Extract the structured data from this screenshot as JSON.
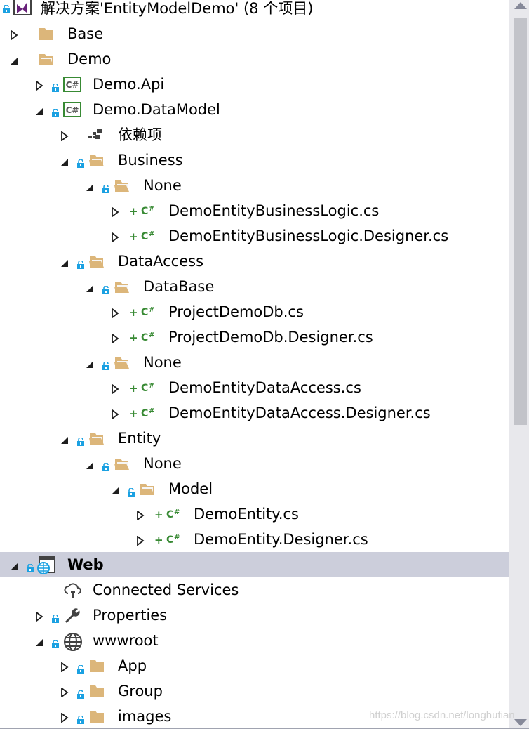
{
  "colors": {
    "selected_row": "#cccedb",
    "folder": "#dcb67a",
    "csharp": "#388a34",
    "lock": "#1ba1e2",
    "scrollbar_thumb": "#c2c3c9"
  },
  "tree": [
    {
      "label": "解决方案'EntityModelDemo' (8 个项目)",
      "level": -1,
      "arrow": "none",
      "lock": true,
      "icon": "solution-icon"
    },
    {
      "label": "Base",
      "level": 0,
      "arrow": "collapsed",
      "lock": false,
      "icon": "folder-icon"
    },
    {
      "label": "Demo",
      "level": 0,
      "arrow": "expanded",
      "lock": false,
      "icon": "folder-open-icon"
    },
    {
      "label": "Demo.Api",
      "level": 1,
      "arrow": "collapsed",
      "lock": true,
      "icon": "csharp-project-icon"
    },
    {
      "label": "Demo.DataModel",
      "level": 1,
      "arrow": "expanded",
      "lock": true,
      "icon": "csharp-project-icon"
    },
    {
      "label": "依赖项",
      "level": 2,
      "arrow": "collapsed",
      "lock": false,
      "icon": "dependencies-icon"
    },
    {
      "label": "Business",
      "level": 2,
      "arrow": "expanded",
      "lock": true,
      "icon": "folder-open-icon"
    },
    {
      "label": "None",
      "level": 3,
      "arrow": "expanded",
      "lock": true,
      "icon": "folder-open-icon"
    },
    {
      "label": "DemoEntityBusinessLogic.cs",
      "level": 4,
      "arrow": "collapsed",
      "lock": false,
      "icon": "csharp-file-icon",
      "added": true
    },
    {
      "label": "DemoEntityBusinessLogic.Designer.cs",
      "level": 4,
      "arrow": "collapsed",
      "lock": false,
      "icon": "csharp-file-icon",
      "added": true
    },
    {
      "label": "DataAccess",
      "level": 2,
      "arrow": "expanded",
      "lock": true,
      "icon": "folder-open-icon"
    },
    {
      "label": "DataBase",
      "level": 3,
      "arrow": "expanded",
      "lock": true,
      "icon": "folder-open-icon"
    },
    {
      "label": "ProjectDemoDb.cs",
      "level": 4,
      "arrow": "collapsed",
      "lock": false,
      "icon": "csharp-file-icon",
      "added": true
    },
    {
      "label": "ProjectDemoDb.Designer.cs",
      "level": 4,
      "arrow": "collapsed",
      "lock": false,
      "icon": "csharp-file-icon",
      "added": true
    },
    {
      "label": "None",
      "level": 3,
      "arrow": "expanded",
      "lock": true,
      "icon": "folder-open-icon"
    },
    {
      "label": "DemoEntityDataAccess.cs",
      "level": 4,
      "arrow": "collapsed",
      "lock": false,
      "icon": "csharp-file-icon",
      "added": true
    },
    {
      "label": "DemoEntityDataAccess.Designer.cs",
      "level": 4,
      "arrow": "collapsed",
      "lock": false,
      "icon": "csharp-file-icon",
      "added": true
    },
    {
      "label": "Entity",
      "level": 2,
      "arrow": "expanded",
      "lock": true,
      "icon": "folder-open-icon"
    },
    {
      "label": "None",
      "level": 3,
      "arrow": "expanded",
      "lock": true,
      "icon": "folder-open-icon"
    },
    {
      "label": "Model",
      "level": 4,
      "arrow": "expanded",
      "lock": true,
      "icon": "folder-open-icon"
    },
    {
      "label": "DemoEntity.cs",
      "level": 5,
      "arrow": "collapsed",
      "lock": false,
      "icon": "csharp-file-icon",
      "added": true
    },
    {
      "label": "DemoEntity.Designer.cs",
      "level": 5,
      "arrow": "collapsed",
      "lock": false,
      "icon": "csharp-file-icon",
      "added": true
    },
    {
      "label": "Web",
      "level": 0,
      "arrow": "expanded",
      "lock": true,
      "icon": "web-project-icon",
      "selected": true
    },
    {
      "label": "Connected Services",
      "level": 1,
      "arrow": "none",
      "lock": false,
      "icon": "connected-services-icon"
    },
    {
      "label": "Properties",
      "level": 1,
      "arrow": "collapsed",
      "lock": true,
      "icon": "wrench-icon"
    },
    {
      "label": "wwwroot",
      "level": 1,
      "arrow": "expanded",
      "lock": true,
      "icon": "globe-icon"
    },
    {
      "label": "App",
      "level": 2,
      "arrow": "collapsed",
      "lock": true,
      "icon": "folder-icon"
    },
    {
      "label": "Group",
      "level": 2,
      "arrow": "collapsed",
      "lock": true,
      "icon": "folder-icon"
    },
    {
      "label": "images",
      "level": 2,
      "arrow": "collapsed",
      "lock": true,
      "icon": "folder-icon"
    }
  ],
  "watermark": "https://blog.csdn.net/longhutian"
}
